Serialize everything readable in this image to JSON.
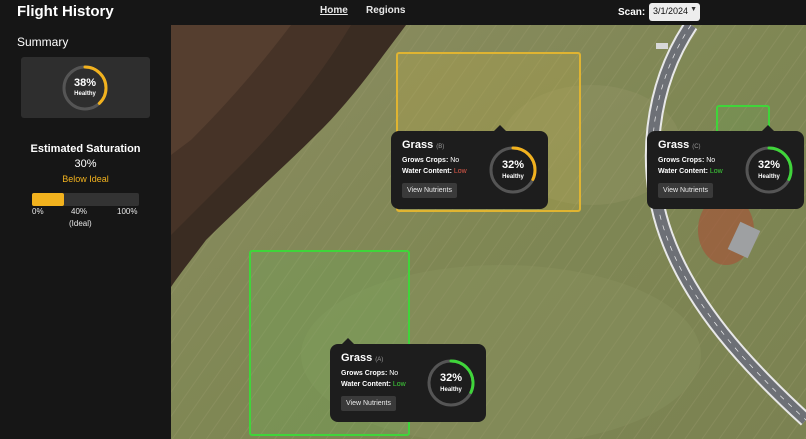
{
  "header": {
    "title": "Flight History",
    "nav": [
      {
        "label": "Home"
      },
      {
        "label": "Regions"
      }
    ],
    "scan_label": "Scan:",
    "scan_value": "3/1/2024"
  },
  "sidebar": {
    "summary_title": "Summary",
    "summary_pct": "38%",
    "summary_pct_value": 0.38,
    "summary_sub": "Healthy",
    "saturation_title": "Estimated Saturation",
    "saturation_value": "30%",
    "saturation_fill": 0.3,
    "saturation_status": "Below Ideal",
    "ticks": [
      "0%",
      "40%",
      "100%"
    ],
    "ideal_label": "(Ideal)"
  },
  "regions": [
    {
      "name": "Grass",
      "id": "(B)",
      "grows_label": "Grows Crops:",
      "grows_value": "No",
      "water_label": "Water Content:",
      "water_value": "Low",
      "pct": "32%",
      "pct_value": 0.32,
      "sub": "Healthy",
      "button": "View Nutrients",
      "color": "#f2b21e"
    },
    {
      "name": "Grass",
      "id": "(C)",
      "grows_label": "Grows Crops:",
      "grows_value": "No",
      "water_label": "Water Content:",
      "water_value": "Low",
      "pct": "32%",
      "pct_value": 0.32,
      "sub": "Healthy",
      "button": "View Nutrients",
      "color": "#3fd53a"
    },
    {
      "name": "Grass",
      "id": "(A)",
      "grows_label": "Grows Crops:",
      "grows_value": "No",
      "water_label": "Water Content:",
      "water_value": "Low",
      "pct": "32%",
      "pct_value": 0.32,
      "sub": "Healthy",
      "button": "View Nutrients",
      "color": "#3fd53a"
    }
  ],
  "colors": {
    "accent": "#f2b21e",
    "healthy_green": "#3fd53a",
    "low_red": "#e15a4a",
    "panel": "#1d1d1d"
  }
}
